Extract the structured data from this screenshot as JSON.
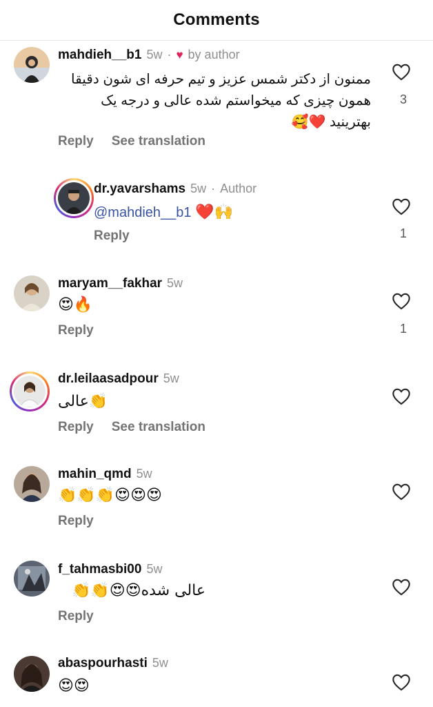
{
  "header": {
    "title": "Comments"
  },
  "comments": [
    {
      "username": "mahdieh__b1",
      "time": "5w",
      "author_tag": "by author",
      "text_line1": "ممنون از دکتر شمس عزیز و تیم حرفه ای شون دقیقا",
      "text_line2": "همون چیزی که میخواستم شده عالی و درجه یک",
      "text_line3": "بهترینید ❤️🥰",
      "reply": "Reply",
      "translate": "See translation",
      "likes": "3"
    },
    {
      "username": "dr.yavarshams",
      "time": "5w",
      "author_tag": "Author",
      "mention": "@mahdieh__b1",
      "text": "❤️🙌",
      "reply": "Reply",
      "likes": "1"
    },
    {
      "username": "maryam__fakhar",
      "time": "5w",
      "text": "😍🔥",
      "reply": "Reply",
      "likes": "1"
    },
    {
      "username": "dr.leilaasadpour",
      "time": "5w",
      "text": "عالی👏",
      "reply": "Reply",
      "translate": "See translation"
    },
    {
      "username": "mahin_qmd",
      "time": "5w",
      "text": "👏👏👏😍😍😍",
      "reply": "Reply"
    },
    {
      "username": "f_tahmasbi00",
      "time": "5w",
      "text": "عالی شده😍😍👏👏",
      "reply": "Reply"
    },
    {
      "username": "abaspourhasti",
      "time": "5w",
      "text": "😍😍"
    }
  ],
  "icons": {
    "like": "heart-outline-icon",
    "author_heart": "heart-filled-icon"
  },
  "colors": {
    "mention": "#3a52a3",
    "heart": "#e0245e",
    "muted": "#8e8e8e"
  }
}
